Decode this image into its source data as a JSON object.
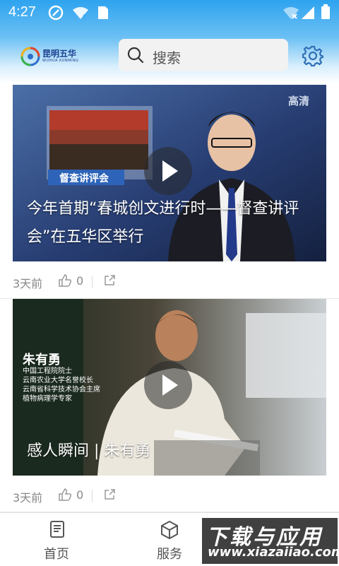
{
  "status_bar": {
    "time": "4:27"
  },
  "header": {
    "logo_text": "昆明五华",
    "logo_subtext": "WUHUA KUNMING",
    "search_placeholder": "搜索"
  },
  "feed": [
    {
      "title": "今年首期“春城创文进行时——督查讲评会”在五华区举行",
      "time_ago": "3天前",
      "like_count": "0",
      "overlay": {
        "channel_label": "高清",
        "screen_caption": "督查讲评会"
      }
    },
    {
      "title": "感人瞬间 | 朱有勇",
      "time_ago": "3天前",
      "like_count": "0",
      "overlay": {
        "name": "朱有勇",
        "bio_lines": [
          "中国工程院院士",
          "云南农业大学名誉校长",
          "云南省科学技术协会主席",
          "植物病理学专家"
        ]
      }
    }
  ],
  "tabbar": {
    "items": [
      {
        "label": "首页"
      },
      {
        "label": "服务"
      },
      {
        "label": ""
      }
    ]
  },
  "watermark": {
    "main": "下载与应用",
    "sub": "www.xiazaiiao.com"
  }
}
